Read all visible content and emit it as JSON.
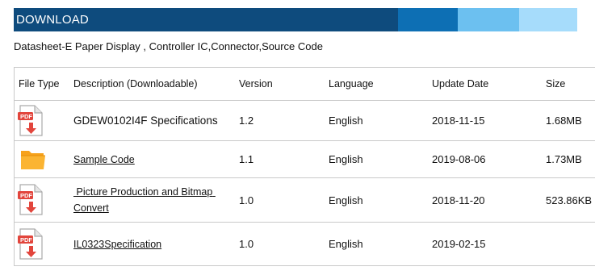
{
  "banner": {
    "title": "DOWNLOAD"
  },
  "subtitle": "Datasheet-E Paper Display , Controller IC,Connector,Source Code",
  "table": {
    "headers": {
      "type": "File Type",
      "description": "Description (Downloadable)",
      "version": "Version",
      "language": "Language",
      "date": "Update Date",
      "size": "Size"
    },
    "rows": [
      {
        "icon": "pdf-icon",
        "description": "GDEW0102I4F Specifications",
        "linked": false,
        "version": "1.2",
        "language": "English",
        "date": "2018-11-15",
        "size": "1.68MB"
      },
      {
        "icon": "folder-icon",
        "description": "Sample Code",
        "linked": true,
        "version": "1.1",
        "language": "English",
        "date": "2019-08-06",
        "size": "1.73MB"
      },
      {
        "icon": "pdf-icon",
        "description": " Picture Production and Bitmap Convert",
        "linked": true,
        "version": "1.0",
        "language": "English",
        "date": "2018-11-20",
        "size": "523.86KB"
      },
      {
        "icon": "pdf-icon",
        "description": "IL0323Specification",
        "linked": true,
        "version": "1.0",
        "language": "English",
        "date": "2019-02-15",
        "size": ""
      }
    ]
  },
  "colors": {
    "banner_main": "#0e4b7d",
    "banner_2": "#0d6fb4",
    "banner_3": "#6cc0f0",
    "banner_4": "#a6dcfb",
    "pdf_red": "#e2453c",
    "folder_orange": "#f7a21b"
  }
}
